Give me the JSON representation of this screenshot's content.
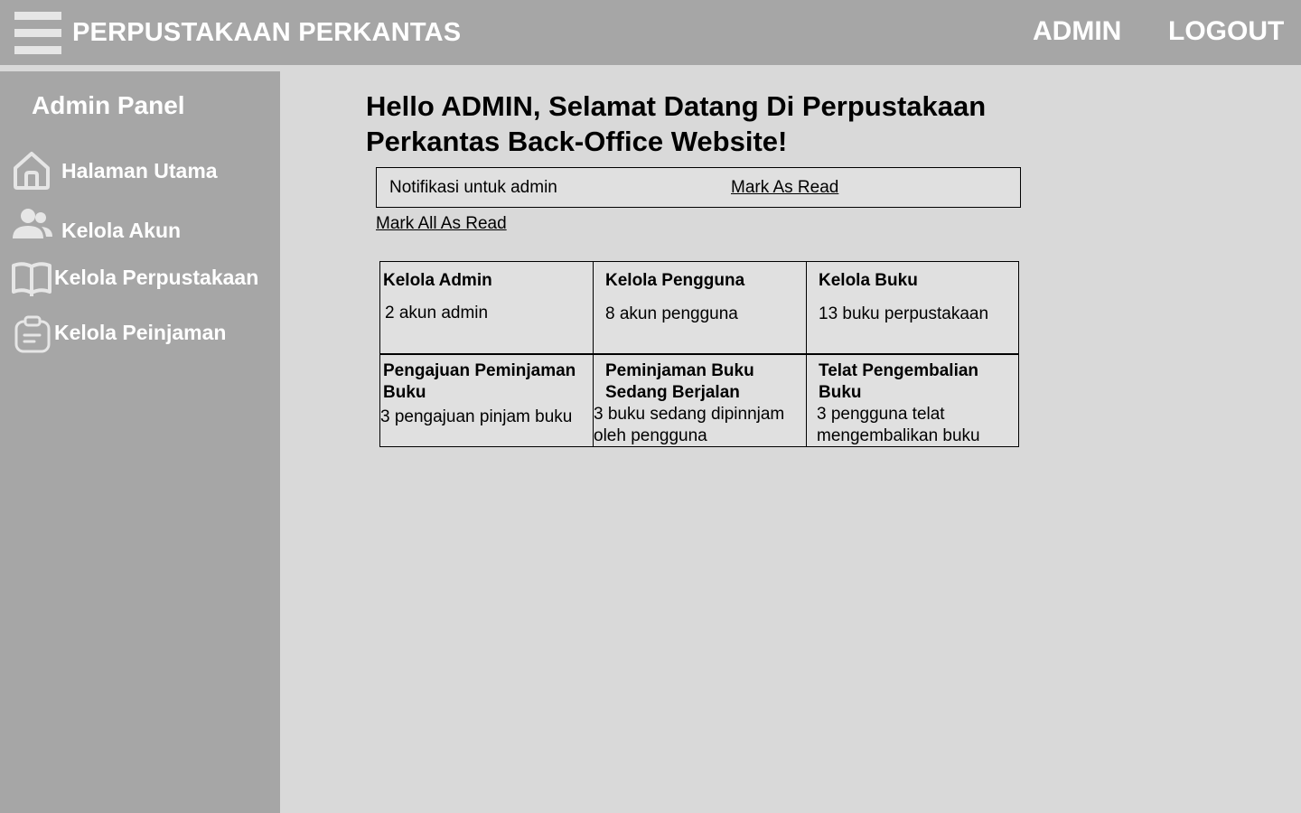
{
  "header": {
    "title": "PERPUSTAKAAN PERKANTAS",
    "nav": {
      "admin": "ADMIN",
      "logout": "LOGOUT"
    }
  },
  "sidebar": {
    "title": "Admin Panel",
    "items": [
      {
        "label": "Halaman Utama",
        "icon": "home-icon"
      },
      {
        "label": "Kelola Akun",
        "icon": "users-icon"
      },
      {
        "label": "Kelola Perpustakaan",
        "icon": "book-icon"
      },
      {
        "label": "Kelola Peinjaman",
        "icon": "clipboard-icon"
      }
    ]
  },
  "main": {
    "greeting": "Hello ADMIN, Selamat Datang Di Perpustakaan Perkantas Back-Office Website!",
    "notification": {
      "text": "Notifikasi untuk admin",
      "action": "Mark As Read"
    },
    "mark_all": "Mark All As Read",
    "stats": [
      {
        "title": "Kelola Admin",
        "value": "2 akun admin"
      },
      {
        "title": "Kelola Pengguna",
        "value": "8 akun pengguna"
      },
      {
        "title": "Kelola Buku",
        "value": "13 buku perpustakaan"
      },
      {
        "title": "Pengajuan Peminjaman Buku",
        "value": "3 pengajuan pinjam buku"
      },
      {
        "title": "Peminjaman Buku Sedang Berjalan",
        "value": "3 buku sedang dipinnjam oleh pengguna"
      },
      {
        "title": "Telat Pengembalian Buku",
        "value": "3 pengguna telat mengembalikan buku"
      }
    ]
  },
  "colors": {
    "bar": "#a6a6a6",
    "background": "#d9d9d9",
    "panel": "#e0e0e0",
    "icon": "#e6e6e6"
  }
}
